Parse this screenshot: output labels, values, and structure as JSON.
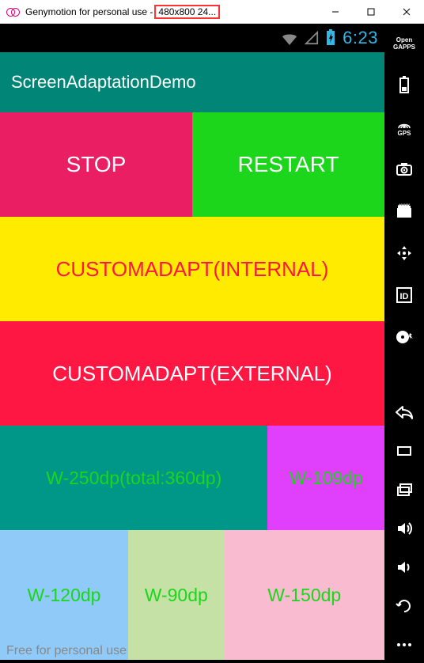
{
  "window": {
    "title_prefix": "Genymotion for personal use -",
    "title_highlight": "480x800 24...",
    "minimize": "–",
    "maximize": "☐",
    "close": "✕"
  },
  "statusbar": {
    "time": "6:23"
  },
  "app": {
    "title": "ScreenAdaptationDemo"
  },
  "row1": {
    "stop": "STOP",
    "restart": "RESTART"
  },
  "row2": {
    "label": "CUSTOMADAPT(INTERNAL)"
  },
  "row3": {
    "label": "CUSTOMADAPT(EXTERNAL)"
  },
  "row4": {
    "a": "W-250dp(total:360dp)",
    "b": "W-109dp"
  },
  "row5": {
    "a": "W-120dp",
    "b": "W-90dp",
    "c": "W-150dp"
  },
  "watermark": "Free for personal use",
  "sidebar": {
    "open_gapps_top": "Open",
    "open_gapps_bot": "GAPPS",
    "gps_label": "GPS",
    "id_label": "ID"
  }
}
